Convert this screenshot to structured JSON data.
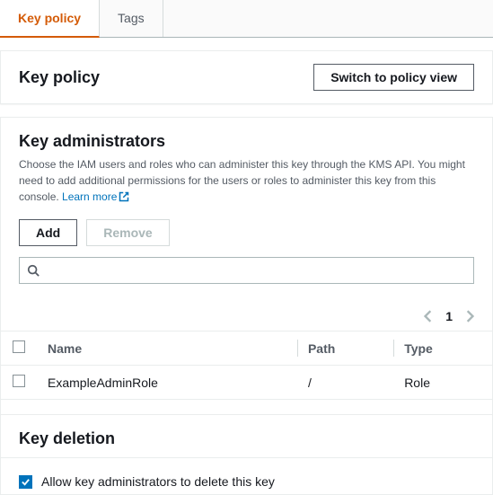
{
  "tabs": {
    "key_policy": "Key policy",
    "tags": "Tags"
  },
  "header": {
    "title": "Key policy",
    "switch_button": "Switch to policy view"
  },
  "admins": {
    "title": "Key administrators",
    "description": "Choose the IAM users and roles who can administer this key through the KMS API. You might need to add additional permissions for the users or roles to administer this key from this console. ",
    "learn_more": "Learn more",
    "add_button": "Add",
    "remove_button": "Remove",
    "search_placeholder": "",
    "pagination": {
      "current": "1"
    },
    "columns": {
      "name": "Name",
      "path": "Path",
      "type": "Type"
    },
    "rows": [
      {
        "name": "ExampleAdminRole",
        "path": "/",
        "type": "Role"
      }
    ]
  },
  "deletion": {
    "title": "Key deletion",
    "allow_label": "Allow key administrators to delete this key",
    "allow_checked": true
  }
}
